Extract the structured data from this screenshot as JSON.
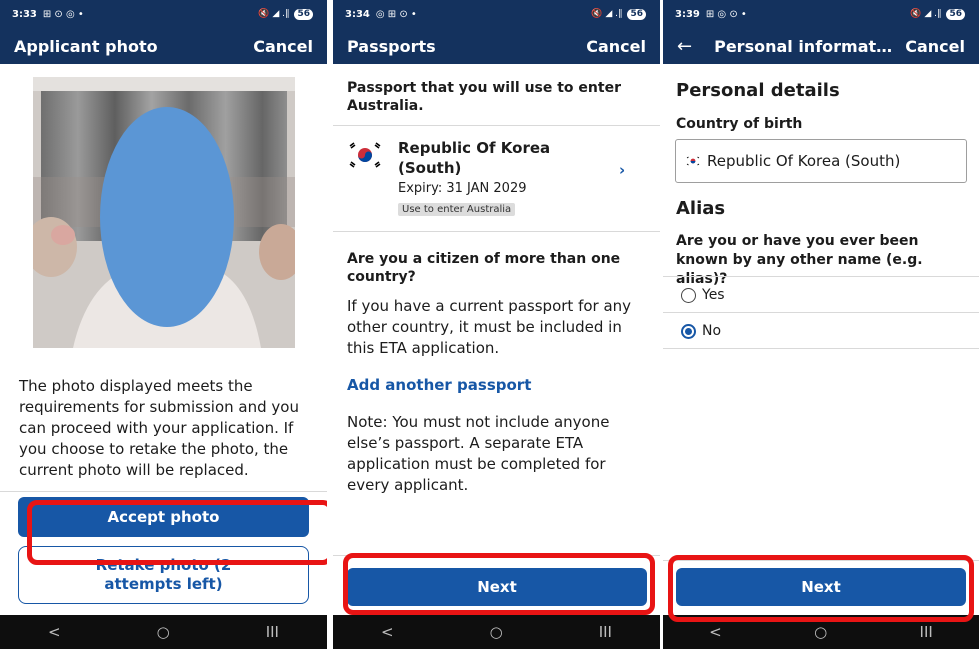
{
  "colors": {
    "header": "#14325e",
    "primary": "#1757a6",
    "highlight": "#e81414",
    "link": "#1757a6"
  },
  "screen1": {
    "status": {
      "time": "3:33",
      "left_icons": "⊞ ⊙ ◎ •",
      "right_icons": "🔇 ◢ .∥",
      "battery": "56"
    },
    "title": "Applicant photo",
    "cancel": "Cancel",
    "message": "The photo displayed meets the requirements for submission and you can proceed with your application. If you choose to retake the photo, the current photo will be replaced.",
    "accept_label": "Accept photo",
    "retake_label": "Retake photo (2 attempts left)"
  },
  "screen2": {
    "status": {
      "time": "3:34",
      "left_icons": "◎ ⊞ ⊙ •",
      "right_icons": "🔇 ◢ .∥",
      "battery": "56"
    },
    "title": "Passports",
    "cancel": "Cancel",
    "intro": "Passport that you will use to enter Australia.",
    "passport": {
      "country": "Republic Of Korea (South)",
      "expiry": "Expiry: 31 JAN 2029",
      "badge": "Use to enter Australia"
    },
    "question": "Are you a citizen of more than one country?",
    "info": "If you have a current passport for any other country, it must be included in this ETA application.",
    "add_link": "Add another passport",
    "note": "Note: You must not include anyone else’s passport. A separate ETA application must be completed for every applicant.",
    "next_label": "Next"
  },
  "screen3": {
    "status": {
      "time": "3:39",
      "left_icons": "⊞ ◎ ⊙ •",
      "right_icons": "🔇 ◢ .∥",
      "battery": "56"
    },
    "title": "Personal informati...",
    "cancel": "Cancel",
    "section1": "Personal details",
    "country_label": "Country of birth",
    "country_value": "Republic Of Korea (South)",
    "section2": "Alias",
    "alias_question": "Are you or have you ever been known by any other name (e.g. alias)?",
    "options": [
      {
        "label": "Yes",
        "selected": false
      },
      {
        "label": "No",
        "selected": true
      }
    ],
    "next_label": "Next"
  },
  "nav": {
    "back": "<",
    "home": "○",
    "recents": "III"
  }
}
